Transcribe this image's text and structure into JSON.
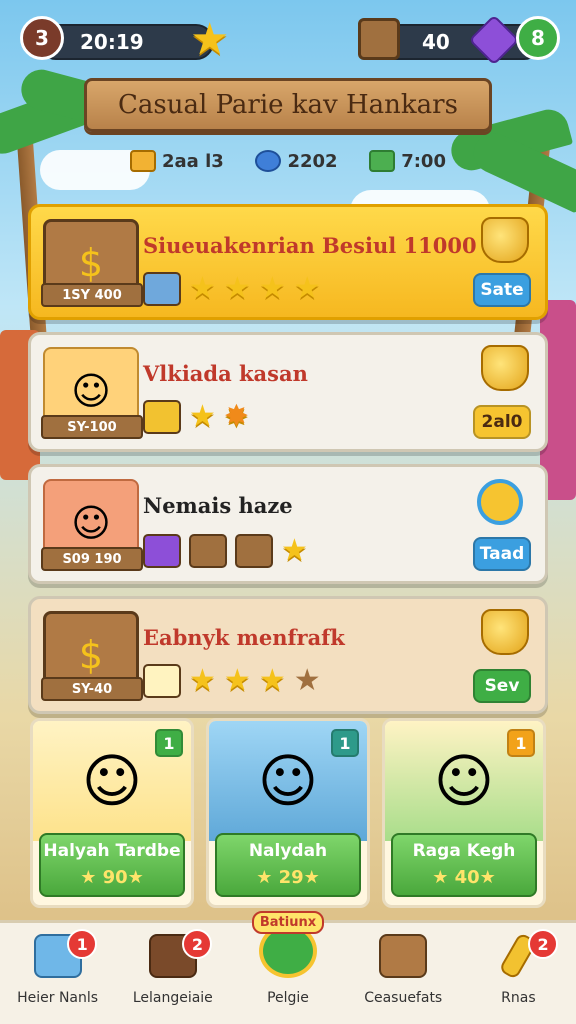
{
  "hud": {
    "level": "3",
    "timer": "20:19",
    "crates": "40",
    "coins_label": "8"
  },
  "title": "Casual Parie kav Hankars",
  "resources": [
    {
      "icon": "ticket-icon",
      "value": "2aa l3"
    },
    {
      "icon": "gem-icon",
      "value": "2202"
    },
    {
      "icon": "wrench-icon",
      "value": "7:00"
    }
  ],
  "cards": [
    {
      "title": "Siueuakenrian Besiul 11000",
      "price": "1SY 400",
      "action": "Sate",
      "stars": 4
    },
    {
      "title": "Vlkiada kasan",
      "price": "SY-100",
      "action": "2al0",
      "stars": 1
    },
    {
      "title": "Nemais haze",
      "price": "S09 190",
      "action": "Taad",
      "stars": 1
    },
    {
      "title": "Eabnyk menfrafk",
      "price": "SY-40",
      "action": "Sev",
      "stars": 4
    }
  ],
  "characters": [
    {
      "name": "Halyah Tardbe",
      "level": "90",
      "badge": "1"
    },
    {
      "name": "Nalydah",
      "level": "29",
      "badge": "1"
    },
    {
      "name": "Raga Kegh",
      "level": "40",
      "badge": "1"
    }
  ],
  "nav": [
    {
      "label": "Heier Nanls",
      "badge": "1"
    },
    {
      "label": "Lelangeiaie",
      "badge": "2"
    },
    {
      "label": "Pelgie",
      "badge": ""
    },
    {
      "label": "Ceasuefats",
      "badge": ""
    },
    {
      "label": "Rnas",
      "badge": "2"
    }
  ],
  "nav_center_tag": "Batiunx",
  "colors": {
    "accent": "#f5c21b",
    "button_blue": "#3b9fe0",
    "button_green": "#3fae45",
    "badge_red": "#e53935"
  }
}
